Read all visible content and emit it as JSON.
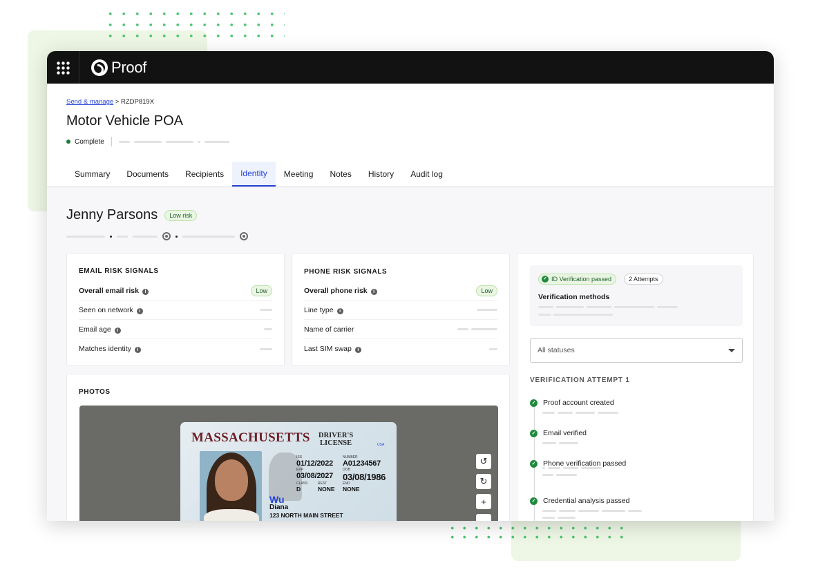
{
  "brand": {
    "name": "Proof"
  },
  "breadcrumb": {
    "link": "Send & manage",
    "separator": ">",
    "current": "RZDP819X"
  },
  "page_title": "Motor Vehicle POA",
  "status": "Complete",
  "tabs": [
    "Summary",
    "Documents",
    "Recipients",
    "Identity",
    "Meeting",
    "Notes",
    "History",
    "Audit log"
  ],
  "active_tab": "Identity",
  "person": {
    "name": "Jenny Parsons",
    "risk_badge": "Low risk"
  },
  "email_signals": {
    "title": "EMAIL RISK SIGNALS",
    "rows": [
      {
        "label": "Overall email risk",
        "value": "Low"
      },
      {
        "label": "Seen on network"
      },
      {
        "label": "Email age"
      },
      {
        "label": "Matches identity"
      }
    ]
  },
  "phone_signals": {
    "title": "PHONE RISK SIGNALS",
    "rows": [
      {
        "label": "Overall phone risk",
        "value": "Low"
      },
      {
        "label": "Line type"
      },
      {
        "label": "Name of carrier"
      },
      {
        "label": "Last SIM swap"
      }
    ]
  },
  "photos": {
    "title": "PHOTOS",
    "id_card": {
      "state": "MASSACHUSETTS",
      "type_line1": "DRIVER'S",
      "type_line2": "LICENSE",
      "country": "USA",
      "iss_label": "ISS",
      "iss": "01/12/2022",
      "exp_label": "EXP",
      "exp": "03/08/2027",
      "number_label": "NUMBER",
      "number": "A01234567",
      "dob_label": "DOB",
      "dob": "03/08/1986",
      "class_label": "CLASS",
      "class": "D",
      "rest_label": "REST",
      "rest": "NONE",
      "end_label": "END",
      "end": "NONE",
      "last_name": "Wu",
      "first_name": "Diana",
      "address": "123 NORTH MAIN STREET"
    },
    "tools": {
      "rotate_left": "↺",
      "rotate_right": "↻",
      "zoom_in": "+"
    }
  },
  "verification": {
    "passed_badge": "ID Verification passed",
    "attempts_badge": "2 Attempts",
    "methods_title": "Verification methods",
    "filter_placeholder": "All statuses",
    "attempt_title": "VERIFICATION ATTEMPT 1",
    "steps": [
      "Proof account created",
      "Email verified",
      "Phone verification passed",
      "Credential analysis passed"
    ]
  },
  "colors": {
    "accent": "#2444d8",
    "success": "#1f8a3d",
    "topbar": "#121212",
    "decor_green": "#eef6e6"
  }
}
